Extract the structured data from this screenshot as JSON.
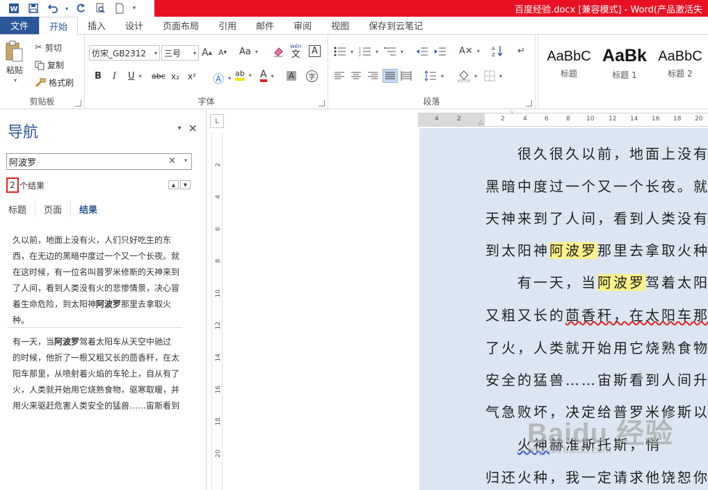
{
  "window": {
    "title": "百度经验.docx [兼容模式] - Word(产品激活失"
  },
  "ribbon_tabs": [
    {
      "label": "文件",
      "active": false,
      "file": true
    },
    {
      "label": "开始",
      "active": true
    },
    {
      "label": "插入"
    },
    {
      "label": "设计"
    },
    {
      "label": "页面布局"
    },
    {
      "label": "引用"
    },
    {
      "label": "邮件"
    },
    {
      "label": "审阅"
    },
    {
      "label": "视图"
    },
    {
      "label": "保存到云笔记"
    }
  ],
  "clipboard": {
    "paste": "粘贴",
    "cut": "剪切",
    "copy": "复制",
    "format_painter": "格式刷",
    "label": "剪贴板"
  },
  "font": {
    "name": "仿宋_GB2312",
    "size": "三号",
    "label": "字体",
    "aa": "Aa",
    "wen": "wén",
    "wen_char": "文",
    "a_box": "A",
    "bold": "B",
    "italic": "I",
    "underline": "U",
    "strike": "abc",
    "sub": "x₂",
    "sup": "x²",
    "highlight": "ab",
    "font_color": "A",
    "shade": "A",
    "enclose": "字"
  },
  "paragraph": {
    "label": "段落"
  },
  "styles": [
    {
      "sample": "AaBbC",
      "name": "标题"
    },
    {
      "sample": "AaBk",
      "name": "标题 1"
    },
    {
      "sample": "AaBbC",
      "name": "标题 2"
    }
  ],
  "nav": {
    "title": "导航",
    "search_value": "阿波罗",
    "result_num": "2",
    "result_suffix": "个结果",
    "tabs": [
      "标题",
      "页面",
      "结果"
    ],
    "results": [
      {
        "before": "久以前，地面上没有火，人们只好吃生的东西，在无边的黑暗中度过一个又一个长夜。就在这时候，有一位名叫普罗米修斯的天神来到了人间，看到人类没有火的悲惨情景，决心冒着生命危险，到太阳神",
        "match": "阿波罗",
        "after": "那里去拿取火种。"
      },
      {
        "before": "有一天，当",
        "match": "阿波罗",
        "after": "驾着太阳车从天空中驰过的时候，他折了一根又粗又长的茴香秆，在太阳车那里，从喷射着火焰的车轮上，自从有了火，人类就开始用它烧熟食物，驱寒取暖，并用火来驱赶危害人类安全的猛兽……宙斯看到"
      }
    ]
  },
  "rulers": {
    "h_ticks": [
      "4",
      "2",
      "2",
      "4",
      "6",
      "8",
      "10",
      "12",
      "14",
      "16",
      "18",
      "20"
    ],
    "v_ticks": [
      "2",
      "4",
      "6",
      "8",
      "10",
      "12",
      "14",
      "16",
      "18",
      "20"
    ],
    "corner": "L"
  },
  "document": {
    "lines": [
      {
        "a": "很久很久以前，地面上没有",
        "b": "",
        "c": ""
      },
      {
        "a": "黑暗中度过一个又一个长夜。就",
        "b": "",
        "c": ""
      },
      {
        "a": "天神来到了人间，看到人类没有",
        "b": "",
        "c": ""
      },
      {
        "a": "到太阳神",
        "b": "阿波罗",
        "c": "那里去拿取火种"
      },
      {
        "a": "有一天，当",
        "b": "阿波罗",
        "c": "驾着太阳"
      },
      {
        "a": "又粗又长的",
        "b": "",
        "c": "茴香秆，在太阳车那"
      },
      {
        "a": "了火，人类就开始用它烧熟食物",
        "b": "",
        "c": ""
      },
      {
        "a": "安全的猛兽……宙斯看到人间升",
        "b": "",
        "c": ""
      },
      {
        "a": "气急败坏，决定给普罗米修斯以",
        "b": "",
        "c": ""
      },
      {
        "a": "火神",
        "b": "",
        "c": "赫淮斯托斯，悄"
      },
      {
        "a": "归还火种，我一定请求他饶恕你",
        "b": "",
        "c": ""
      }
    ]
  },
  "watermark": {
    "big": "Baidu 经验",
    "small": "jingyan.baidu.com"
  }
}
